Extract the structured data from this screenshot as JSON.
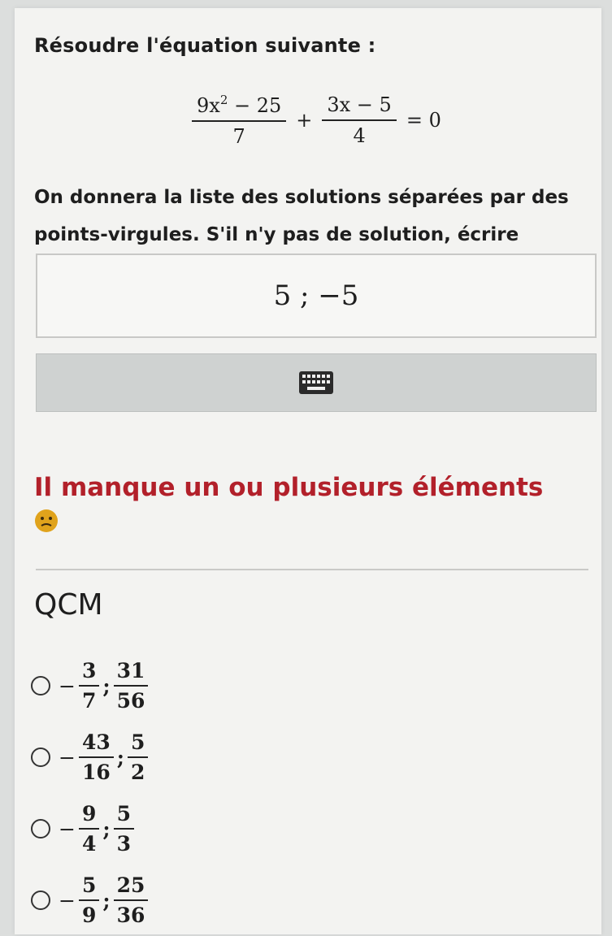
{
  "question": {
    "prompt": "Résoudre l'équation suivante :",
    "equation": {
      "term1_num_base": "9x",
      "term1_num_exp": "2",
      "term1_num_rest": " − 25",
      "term1_den": "7",
      "operator": "+",
      "term2_num": "3x − 5",
      "term2_den": "4",
      "rhs": "= 0"
    },
    "instructions": "On donnera la liste des solutions séparées par des points-virgules. S'il n'y pas de solution, écrire \"Aucune\"."
  },
  "answer": {
    "value": "5 ; −5"
  },
  "feedback": {
    "message": "Il manque un ou plusieurs éléments"
  },
  "qcm": {
    "title": "QCM",
    "options": [
      {
        "sign": "−",
        "a_num": "3",
        "a_den": "7",
        "sep": ";",
        "b_num": "31",
        "b_den": "56"
      },
      {
        "sign": "−",
        "a_num": "43",
        "a_den": "16",
        "sep": ";",
        "b_num": "5",
        "b_den": "2"
      },
      {
        "sign": "−",
        "a_num": "9",
        "a_den": "4",
        "sep": ";",
        "b_num": "5",
        "b_den": "3"
      },
      {
        "sign": "−",
        "a_num": "5",
        "a_den": "9",
        "sep": ";",
        "b_num": "25",
        "b_den": "36"
      }
    ]
  },
  "colors": {
    "error": "#b2202a",
    "emoji": "#e0a31c"
  },
  "icons": {
    "keyboard": "keyboard-icon",
    "emoji": "sad-face-icon",
    "radio": "radio-icon"
  }
}
